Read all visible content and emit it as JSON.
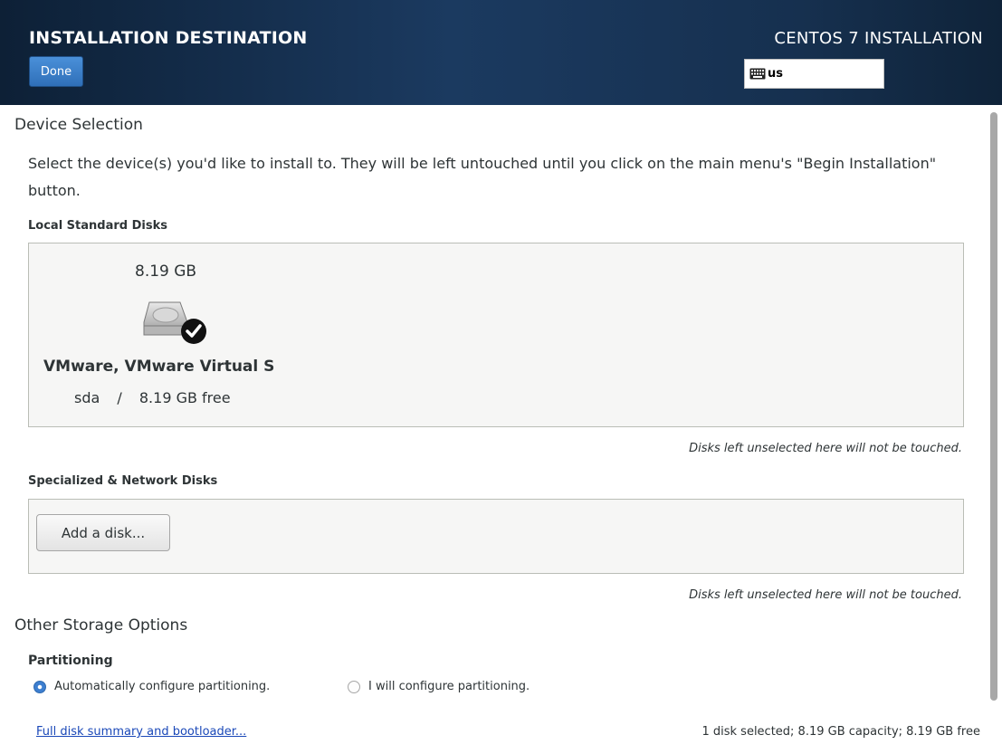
{
  "header": {
    "title": "INSTALLATION DESTINATION",
    "done_label": "Done",
    "product": "CENTOS 7 INSTALLATION",
    "keyboard_layout": "us"
  },
  "device_selection": {
    "title": "Device Selection",
    "description": "Select the device(s) you'd like to install to.  They will be left untouched until you click on the main menu's \"Begin Installation\" button.",
    "local_disks_heading": "Local Standard Disks",
    "disks": [
      {
        "size": "8.19 GB",
        "name": "VMware, VMware Virtual S",
        "device": "sda",
        "separator": "/",
        "free": "8.19 GB free",
        "selected": true,
        "icon": "hard-disk-icon"
      }
    ],
    "local_note": "Disks left unselected here will not be touched.",
    "specialized_heading": "Specialized & Network Disks",
    "add_disk_label": "Add a disk...",
    "specialized_note": "Disks left unselected here will not be touched."
  },
  "other_storage": {
    "title": "Other Storage Options",
    "partitioning_heading": "Partitioning",
    "options": [
      {
        "label": "Automatically configure partitioning.",
        "selected": true
      },
      {
        "label": "I will configure partitioning.",
        "selected": false
      }
    ]
  },
  "footer": {
    "link_label": "Full disk summary and bootloader...",
    "summary": "1 disk selected; 8.19 GB capacity; 8.19 GB free"
  },
  "colors": {
    "accent": "#3d7fd0",
    "header_bg": "#1b3a60",
    "link": "#1a48b8"
  }
}
